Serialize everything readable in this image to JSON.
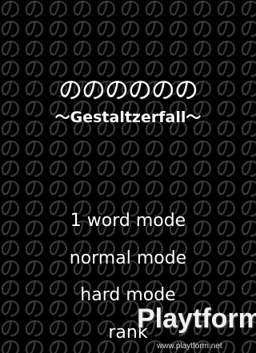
{
  "background": {
    "glyph": "の"
  },
  "title": "のののののの",
  "subtitle": "〜Gestaltzerfall〜",
  "menu": [
    {
      "label": "1 word mode"
    },
    {
      "label": "normal mode"
    },
    {
      "label": "hard mode"
    },
    {
      "label": "rank"
    }
  ],
  "watermark": {
    "brand": "Playtform",
    "url": "www.playtform.net"
  },
  "colors": {
    "background": "#000000",
    "pattern": "#3b3b3b",
    "text": "#ffffff"
  }
}
